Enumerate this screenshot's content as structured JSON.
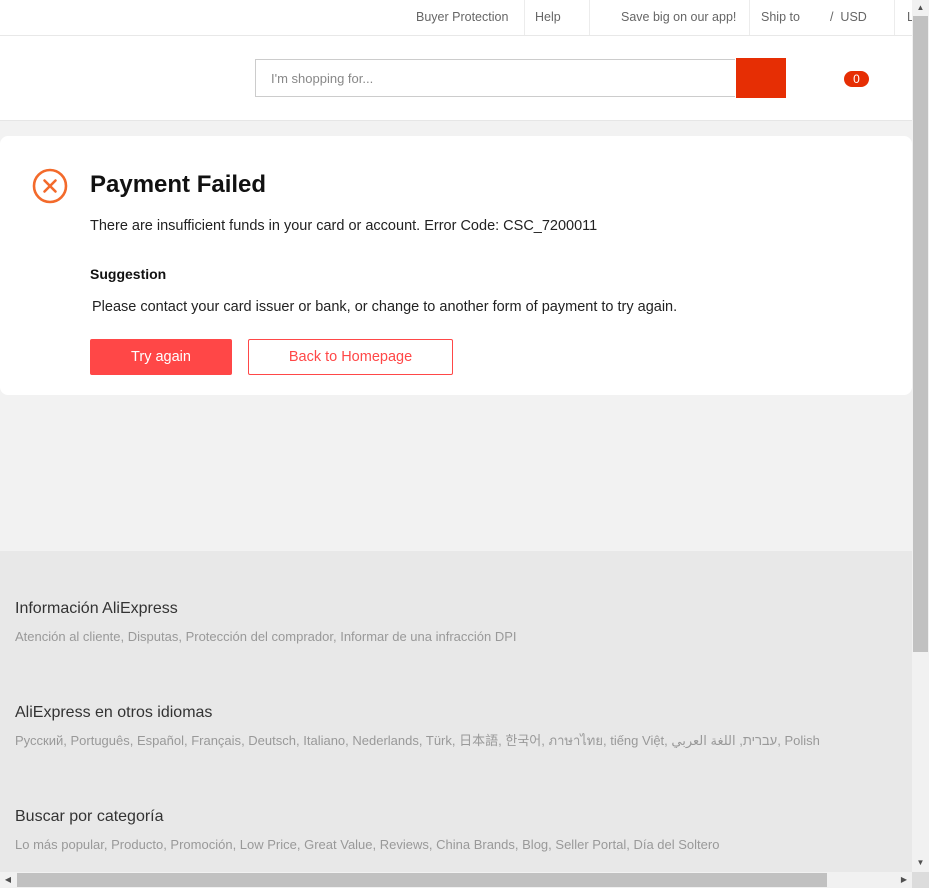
{
  "topbar": {
    "buyer_protection": "Buyer Protection",
    "help": "Help",
    "app_promo": "Save big on our app!",
    "ship_to": "Ship to",
    "currency": "/  USD",
    "cut_item": "L"
  },
  "header": {
    "search_placeholder": "I'm shopping for...",
    "cart_count": "0"
  },
  "result": {
    "title": "Payment Failed",
    "message": "There are insufficient funds in your card or account. Error Code: CSC_7200011",
    "suggestion_heading": "Suggestion",
    "suggestion_text": "Please contact your card issuer or bank, or change to another form of payment to try again.",
    "try_again_label": "Try again",
    "home_label": "Back to Homepage",
    "icon": "close-circle-icon",
    "accent_color": "#ff4747"
  },
  "footer": {
    "sections": [
      {
        "heading": "Información AliExpress",
        "links": [
          "Atención al cliente",
          "Disputas",
          "Protección del comprador",
          "Informar de una infracción DPI"
        ]
      },
      {
        "heading": "AliExpress en otros idiomas",
        "links": [
          "Русский",
          "Português",
          "Español",
          "Français",
          "Deutsch",
          "Italiano",
          "Nederlands",
          "Türk",
          "日本語",
          "한국어",
          "ภาษาไทย",
          "tiếng Việt",
          "עברית",
          "اللغة العربي",
          "Polish"
        ]
      },
      {
        "heading": "Buscar por categoría",
        "links": [
          "Lo más popular",
          "Producto",
          "Promoción",
          "Low Price",
          "Great Value",
          "Reviews",
          "China Brands",
          "Blog",
          "Seller Portal",
          "Día del Soltero"
        ]
      }
    ]
  }
}
